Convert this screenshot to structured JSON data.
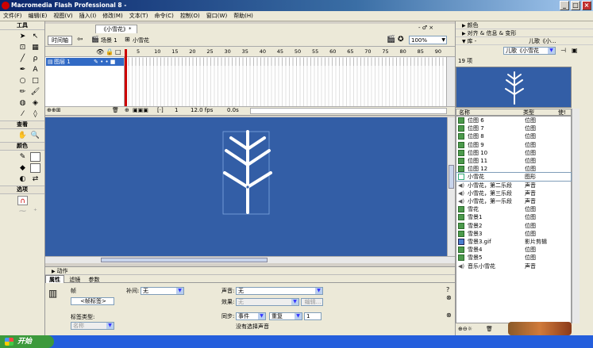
{
  "titlebar": {
    "title": "Macromedia Flash Professional 8 -"
  },
  "menu": [
    "文件(F)",
    "编辑(E)",
    "视图(V)",
    "插入(I)",
    "修改(M)",
    "文本(T)",
    "命令(C)",
    "控制(O)",
    "窗口(W)",
    "帮助(H)"
  ],
  "tools": {
    "title": "工具",
    "view_label": "查看",
    "colors_label": "颜色",
    "options_label": "选项"
  },
  "document": {
    "tab_label": "《小雪花》*",
    "timeline_button": "时间轴",
    "scene_label": "场景 1",
    "symbol_label": "小雪花",
    "zoom": "100%"
  },
  "timeline": {
    "layer_name": "图层 1",
    "frame_numbers": [
      "5",
      "10",
      "15",
      "20",
      "25",
      "30",
      "35",
      "40",
      "45",
      "50",
      "55",
      "60",
      "65",
      "70",
      "75",
      "80",
      "85",
      "90"
    ],
    "current_frame": "1",
    "fps": "12.0 fps",
    "time": "0.0s"
  },
  "actions_panel": {
    "label": "动作"
  },
  "properties": {
    "tabs": [
      "属性",
      "滤镜",
      "参数"
    ],
    "frame_label": "帧",
    "frame_label_placeholder": "<帧标签>",
    "tween_label": "补间:",
    "tween_value": "无",
    "sound_label": "声音:",
    "sound_value": "无",
    "effect_label": "效果:",
    "effect_value": "无",
    "edit_button": "编辑...",
    "label_type_label": "标签类型:",
    "label_type_value": "名称",
    "sync_label": "同步:",
    "sync_value": "事件",
    "repeat_value": "重复",
    "repeat_count": "1",
    "no_sound_text": "没有选择声音"
  },
  "right_panels": {
    "color_panel": "颜色",
    "align_panel": "对齐 & 信息 & 变形",
    "library_panel": "库 -",
    "library_doc": "儿歌《小...",
    "library_select": "儿歌《小雪花",
    "item_count": "19 项",
    "col_name": "名称",
    "col_type": "类型",
    "col_use": "使!"
  },
  "library_items": [
    {
      "name": "位图 6",
      "type": "位图",
      "icon": "bitmap"
    },
    {
      "name": "位图 7",
      "type": "位图",
      "icon": "bitmap"
    },
    {
      "name": "位图 8",
      "type": "位图",
      "icon": "bitmap"
    },
    {
      "name": "位图 9",
      "type": "位图",
      "icon": "bitmap"
    },
    {
      "name": "位图 10",
      "type": "位图",
      "icon": "bitmap"
    },
    {
      "name": "位图 11",
      "type": "位图",
      "icon": "bitmap"
    },
    {
      "name": "位图 12",
      "type": "位图",
      "icon": "bitmap"
    },
    {
      "name": "小雪花",
      "type": "图形",
      "icon": "graphic"
    },
    {
      "name": "小雪花，第二乐段",
      "type": "声音",
      "icon": "sound"
    },
    {
      "name": "小雪花，第三乐段",
      "type": "声音",
      "icon": "sound"
    },
    {
      "name": "小雪花，第一乐段",
      "type": "声音",
      "icon": "sound"
    },
    {
      "name": "雪花",
      "type": "位图",
      "icon": "bitmap"
    },
    {
      "name": "雪景1",
      "type": "位图",
      "icon": "bitmap"
    },
    {
      "name": "雪景2",
      "type": "位图",
      "icon": "bitmap"
    },
    {
      "name": "雪景3",
      "type": "位图",
      "icon": "bitmap"
    },
    {
      "name": "雪景3.gif",
      "type": "影片剪辑",
      "icon": "movieclip"
    },
    {
      "name": "雪景4",
      "type": "位图",
      "icon": "bitmap"
    },
    {
      "name": "雪景5",
      "type": "位图",
      "icon": "bitmap"
    },
    {
      "name": "音乐小雪花",
      "type": "声音",
      "icon": "sound"
    }
  ],
  "taskbar": {
    "start_label": "开始"
  },
  "colors": {
    "stage": "#335ea6",
    "selection": "#316ac5",
    "playhead": "#cc0000"
  }
}
